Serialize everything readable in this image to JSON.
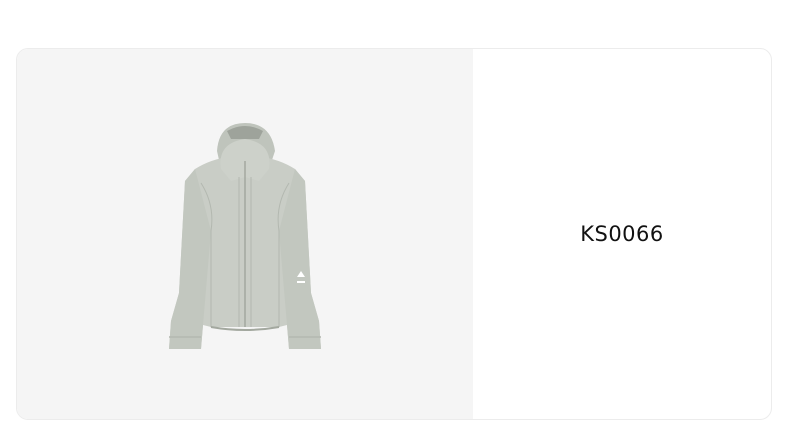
{
  "product": {
    "code": "KS0066",
    "image_subject": "jacket",
    "colors": {
      "image_bg": "#f5f5f5",
      "jacket": "#c9cdc6",
      "jacket_shadow": "#b3b8b0",
      "jacket_line": "#a3a89f"
    }
  }
}
